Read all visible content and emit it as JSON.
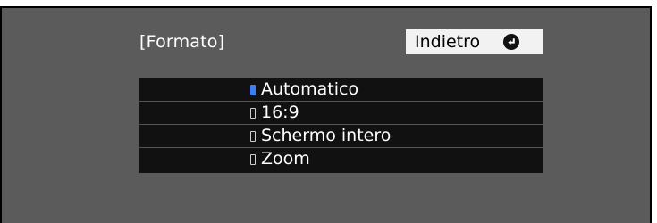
{
  "menu": {
    "title": "[Formato]",
    "back_label": "Indietro",
    "back_icon": "enter-return-icon",
    "options": [
      {
        "label": "Automatico",
        "selected": true
      },
      {
        "label": "16:9",
        "selected": false
      },
      {
        "label": "Schermo intero",
        "selected": false
      },
      {
        "label": "Zoom",
        "selected": false
      }
    ]
  },
  "colors": {
    "panel": "#5b5b5b",
    "options_bg": "#111111",
    "selected_radio": "#3d7ff2",
    "back_button_bg": "#f2f2f2"
  }
}
